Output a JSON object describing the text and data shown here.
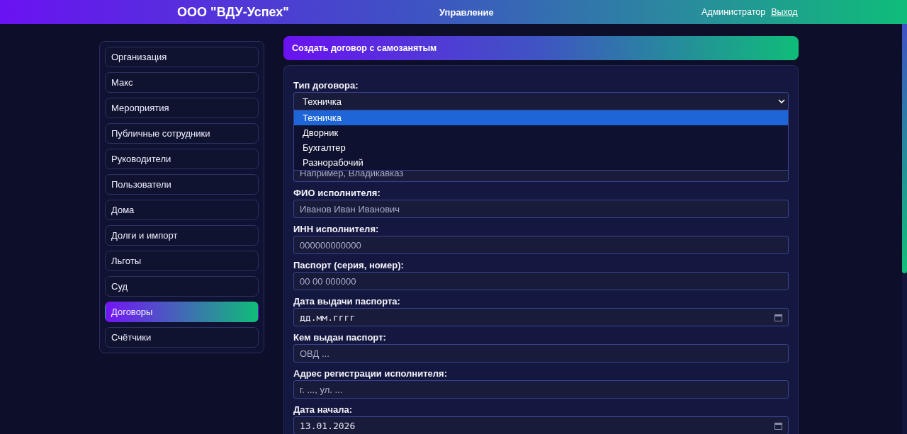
{
  "header": {
    "brand": "ООО \"ВДУ-Успех\"",
    "nav": "Управление",
    "user": "Администратор",
    "logout": "Выход"
  },
  "sidebar": {
    "items": [
      {
        "label": "Организация",
        "selected": false
      },
      {
        "label": "Макс",
        "selected": false
      },
      {
        "label": "Мероприятия",
        "selected": false
      },
      {
        "label": "Публичные сотрудники",
        "selected": false
      },
      {
        "label": "Руководители",
        "selected": false
      },
      {
        "label": "Пользователи",
        "selected": false
      },
      {
        "label": "Дома",
        "selected": false
      },
      {
        "label": "Долги и импорт",
        "selected": false
      },
      {
        "label": "Льготы",
        "selected": false
      },
      {
        "label": "Суд",
        "selected": false
      },
      {
        "label": "Договоры",
        "selected": true
      },
      {
        "label": "Счётчики",
        "selected": false
      }
    ]
  },
  "form": {
    "title": "Создать договор с самозанятым",
    "contract_type": {
      "label": "Тип договора:",
      "value": "Техничка",
      "options": [
        {
          "label": "Техничка",
          "selected": true
        },
        {
          "label": "Дворник",
          "selected": false
        },
        {
          "label": "Бухгалтер",
          "selected": false
        },
        {
          "label": "Разнорабочий",
          "selected": false
        }
      ]
    },
    "covered_field": {
      "placeholder": "Например, Владикавказ"
    },
    "fields": [
      {
        "kind": "text",
        "label": "ФИО исполнителя:",
        "placeholder": "Иванов Иван Иванович"
      },
      {
        "kind": "text",
        "label": "ИНН исполнителя:",
        "placeholder": "000000000000"
      },
      {
        "kind": "text",
        "label": "Паспорт (серия, номер):",
        "placeholder": "00 00 000000"
      },
      {
        "kind": "date",
        "label": "Дата выдачи паспорта:",
        "value": "дд.мм.гггг"
      },
      {
        "kind": "text",
        "label": "Кем выдан паспорт:",
        "placeholder": "ОВД ..."
      },
      {
        "kind": "text",
        "label": "Адрес регистрации исполнителя:",
        "placeholder": "г. ..., ул. ..."
      },
      {
        "kind": "date",
        "label": "Дата начала:",
        "value": "13.01.2026"
      }
    ]
  }
}
